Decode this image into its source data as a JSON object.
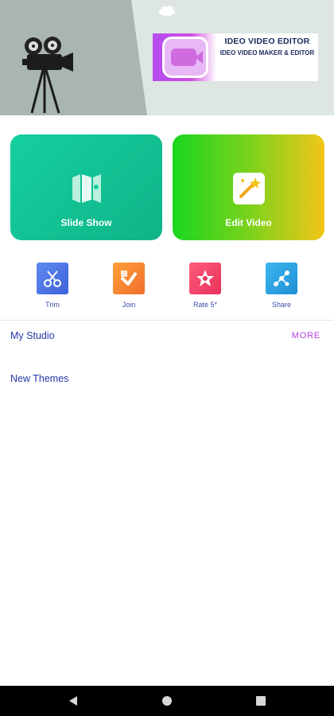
{
  "banner": {
    "title": "IDEO VIDEO EDITOR",
    "subtitle": "IDEO VIDEO MAKER & EDITOR",
    "logo_icon": "video-camera-icon",
    "scene_icon": "film-projector-icon"
  },
  "tiles": [
    {
      "label": "Slide Show",
      "icon": "slideshow-icon",
      "color": "#15cf9f"
    },
    {
      "label": "Edit Video",
      "icon": "magic-wand-icon",
      "color": "#f2c619"
    }
  ],
  "tools": [
    {
      "label": "Trim",
      "icon": "scissors-icon",
      "color": "#3f61d9"
    },
    {
      "label": "Join",
      "icon": "join-icon",
      "color": "#f06f2b"
    },
    {
      "label": "Rate 5*",
      "icon": "star-icon",
      "color": "#e8325c"
    },
    {
      "label": "Share",
      "icon": "share-icon",
      "color": "#1f8fd6"
    }
  ],
  "studio": {
    "title": "My Studio",
    "more_label": "MORE"
  },
  "themes": {
    "title": "New Themes"
  },
  "navbar": {
    "back": "back-icon",
    "home": "home-icon",
    "recents": "recents-icon"
  },
  "colors": {
    "accent": "#b242e5",
    "link": "#2638a8"
  }
}
